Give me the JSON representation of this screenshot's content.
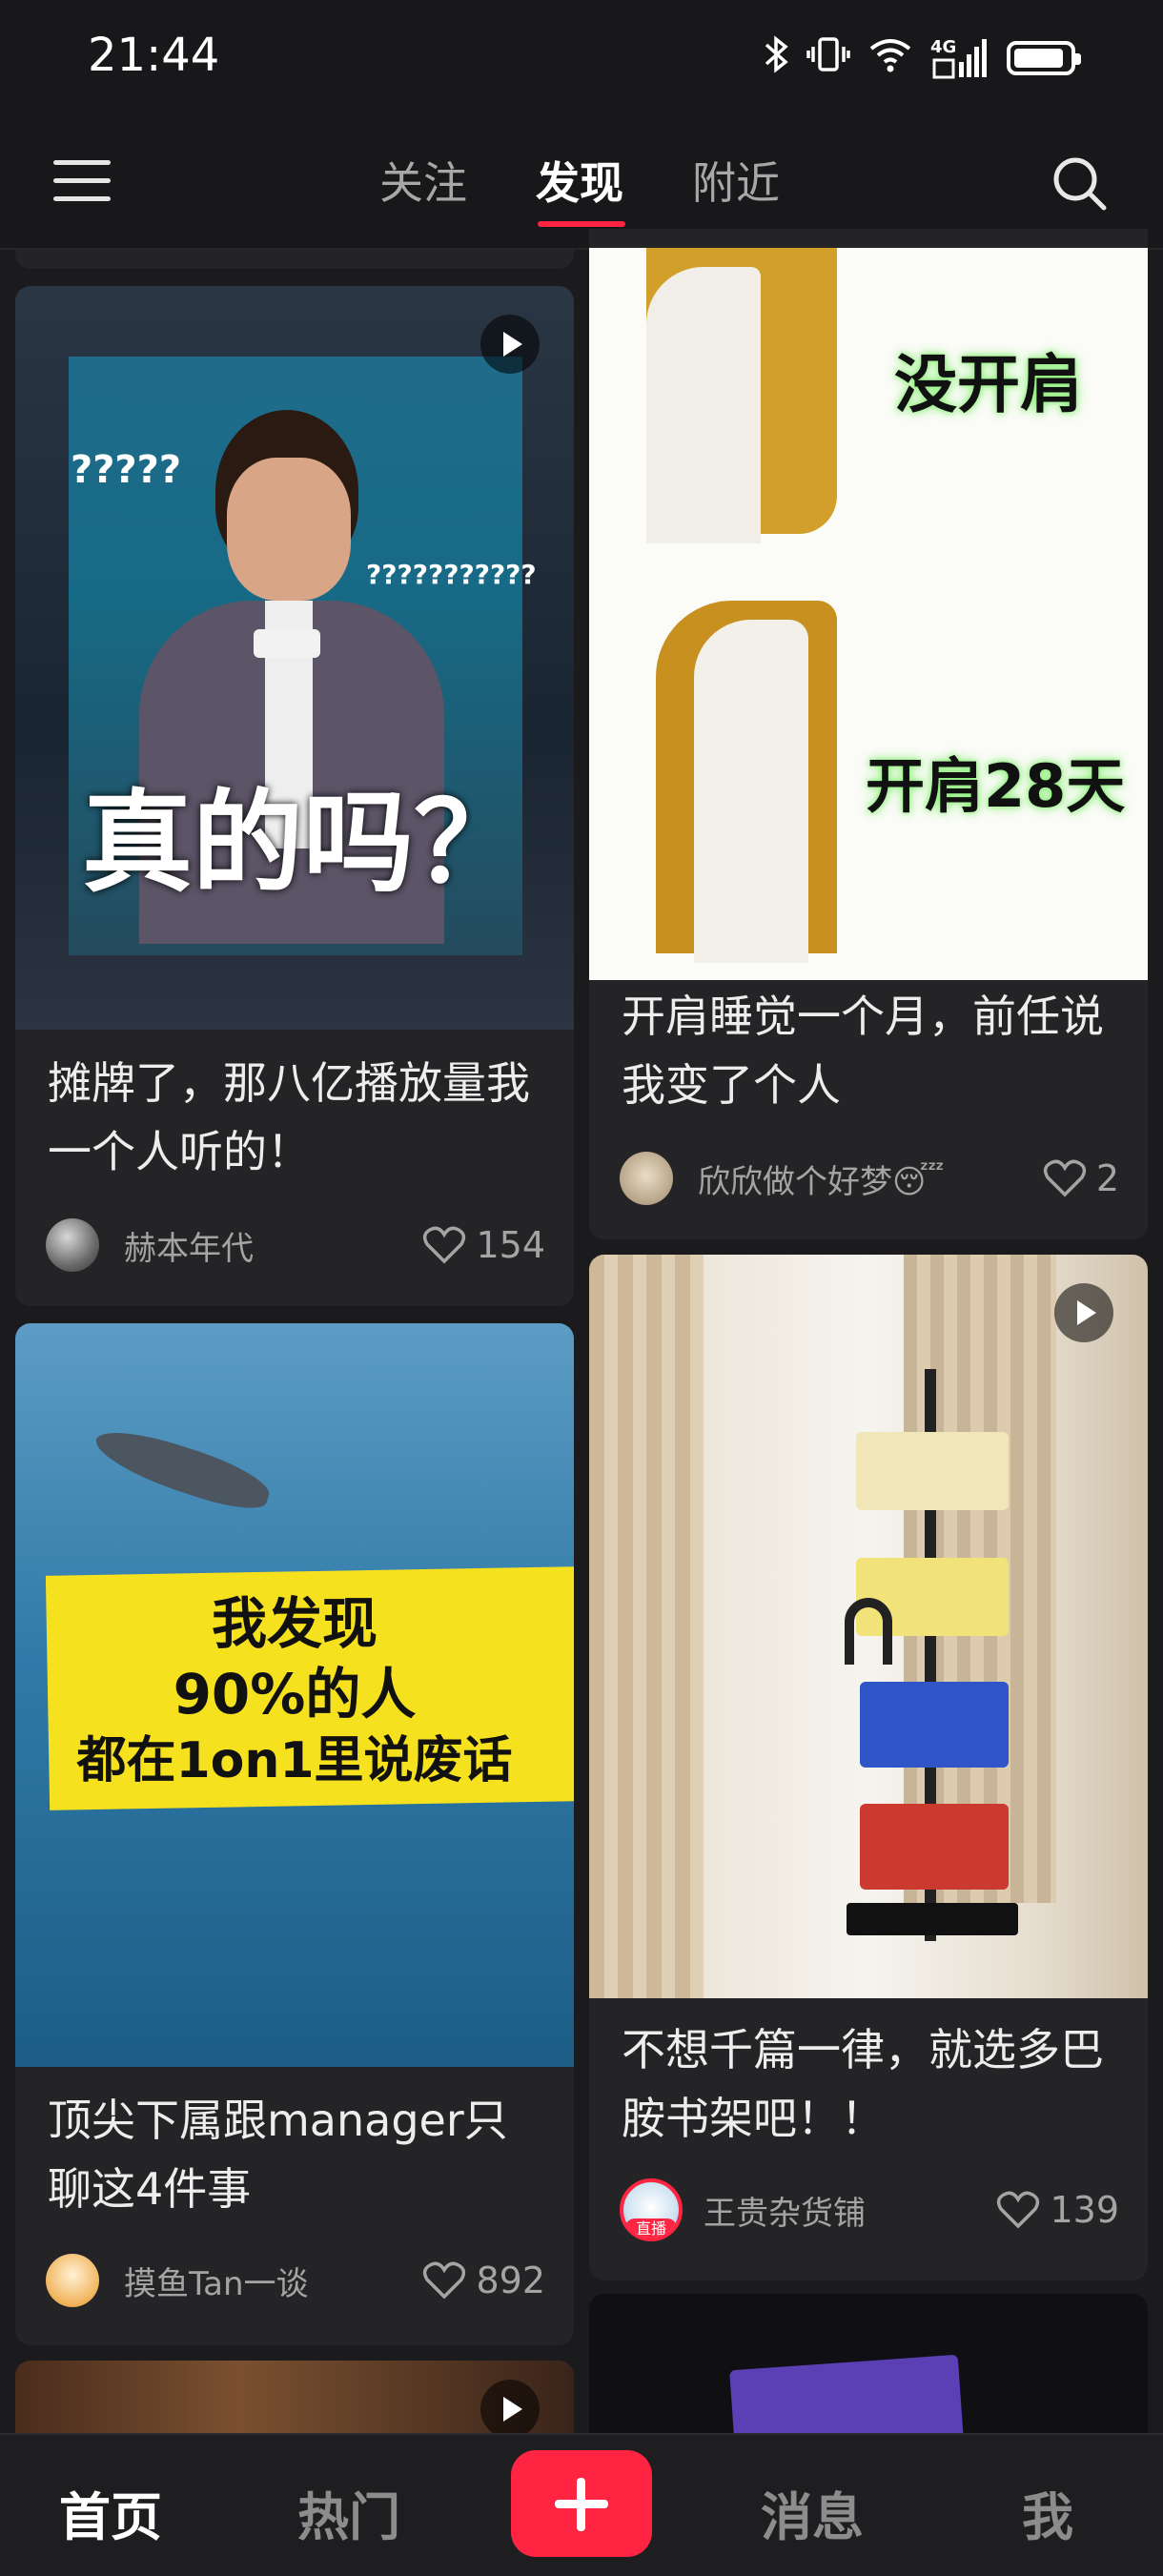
{
  "status_bar": {
    "time": "21:44",
    "signal_label": "4G"
  },
  "top_nav": {
    "tabs": [
      {
        "label": "关注"
      },
      {
        "label": "发现",
        "active": true
      },
      {
        "label": "附近"
      }
    ],
    "accent_color": "#ff2442"
  },
  "feed": {
    "cards": [
      {
        "title": "摊牌了，那八亿播放量我一个人听的！",
        "image_text": [
          "?????",
          "???????????",
          "真的吗？"
        ],
        "is_video": true,
        "author": "赫本年代",
        "likes": "154"
      },
      {
        "title": "开肩睡觉一个月，前任说我变了个人",
        "image_text": [
          "没开肩",
          "开肩28天"
        ],
        "is_video": false,
        "author": "欣欣做个好梦😴",
        "likes": "2"
      },
      {
        "title": "顶尖下属跟manager只聊这4件事",
        "image_text": [
          "我发现",
          "90%的人",
          "都在1on1里说废话"
        ],
        "is_video": false,
        "author": "摸鱼Tan一谈",
        "likes": "892"
      },
      {
        "title": "不想千篇一律，就选多巴胺书架吧！！",
        "is_video": true,
        "author": "王贵杂货铺",
        "live_badge": "直播",
        "likes": "139"
      }
    ]
  },
  "bottom_nav": {
    "items": [
      {
        "label": "首页",
        "active": true
      },
      {
        "label": "热门"
      },
      {
        "label": "消息"
      },
      {
        "label": "我"
      }
    ],
    "add_icon": "plus-icon"
  }
}
